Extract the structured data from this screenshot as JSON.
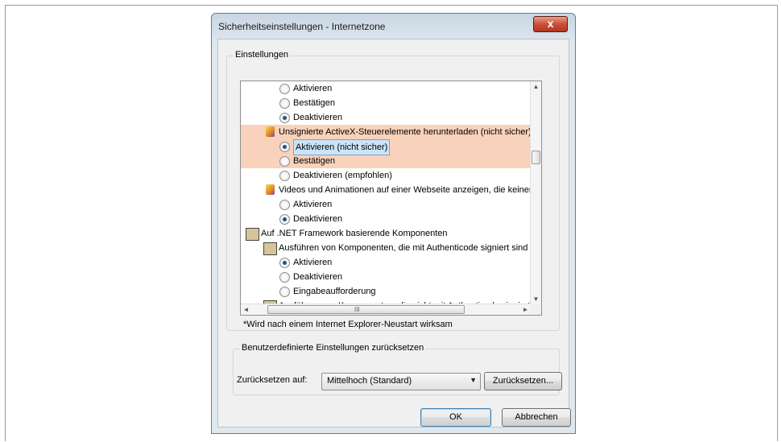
{
  "dialog": {
    "title": "Sicherheitseinstellungen - Internetzone",
    "close_label": "x"
  },
  "settings_group": {
    "label": "Einstellungen"
  },
  "list": [
    {
      "kind": "radio",
      "indent": 2,
      "label": "Aktivieren",
      "checked": false
    },
    {
      "kind": "radio",
      "indent": 2,
      "label": "Bestätigen",
      "checked": false
    },
    {
      "kind": "radio",
      "indent": 2,
      "label": "Deaktivieren",
      "checked": true
    },
    {
      "kind": "ie-icon",
      "indent": 1,
      "label": "Unsignierte ActiveX-Steuerelemente herunterladen (nicht sicher)",
      "highlight": true
    },
    {
      "kind": "radio",
      "indent": 2,
      "label": "Aktivieren (nicht sicher)",
      "checked": true,
      "highlight": true,
      "selected": true
    },
    {
      "kind": "radio",
      "indent": 2,
      "label": "Bestätigen",
      "checked": false,
      "highlight": true
    },
    {
      "kind": "radio",
      "indent": 2,
      "label": "Deaktivieren (empfohlen)",
      "checked": false,
      "highlight": true
    },
    {
      "kind": "ie-icon",
      "indent": 1,
      "label": "Videos und Animationen auf einer Webseite anzeigen, die keinen externen Mediaplayer verwenden"
    },
    {
      "kind": "radio",
      "indent": 2,
      "label": "Aktivieren",
      "checked": false
    },
    {
      "kind": "radio",
      "indent": 2,
      "label": "Deaktivieren",
      "checked": true
    },
    {
      "kind": "net-icon",
      "indent": 0,
      "label": "Auf .NET Framework basierende Komponenten"
    },
    {
      "kind": "net-icon",
      "indent": 1,
      "label": "Ausführen von Komponenten, die mit Authenticode signiert sind"
    },
    {
      "kind": "radio",
      "indent": 2,
      "label": "Aktivieren",
      "checked": true
    },
    {
      "kind": "radio",
      "indent": 2,
      "label": "Deaktivieren",
      "checked": false
    },
    {
      "kind": "radio",
      "indent": 2,
      "label": "Eingabeaufforderung",
      "checked": false
    },
    {
      "kind": "net-icon",
      "indent": 1,
      "label": "Ausführen von Komponenten, die nicht mit Authenticode signiert sind"
    }
  ],
  "scroll": {
    "up": "▲",
    "down": "▼",
    "left": "◄",
    "right": "►",
    "grip": "III"
  },
  "note": "*Wird nach einem Internet Explorer-Neustart wirksam",
  "reset_group": {
    "label": "Benutzerdefinierte Einstellungen zurücksetzen",
    "reset_to_label": "Zurücksetzen auf:",
    "selected_level": "Mittelhoch (Standard)",
    "reset_button": "Zurücksetzen..."
  },
  "buttons": {
    "ok": "OK",
    "cancel": "Abbrechen"
  },
  "colors": {
    "highlight_band": "#f8d2bb",
    "selection": "#cce4f7"
  }
}
